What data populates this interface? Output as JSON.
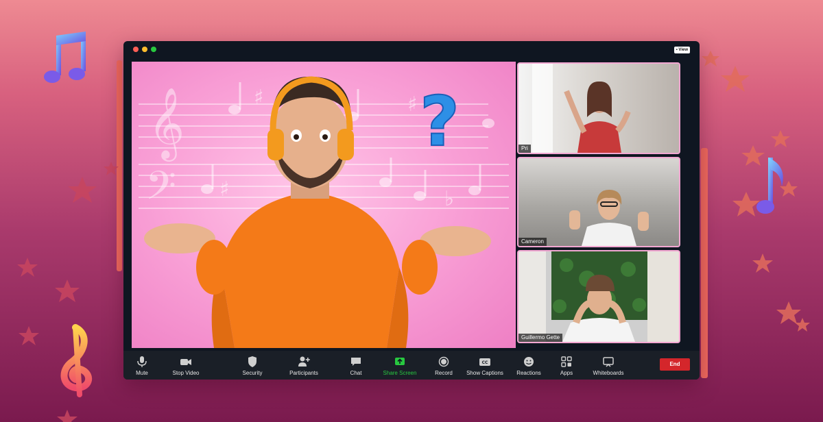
{
  "colors": {
    "accent": "#f06a5e",
    "end_button": "#d4262b",
    "share_green": "#28c840",
    "window_bg": "#0f1621",
    "toolbar_bg": "#1a1f27"
  },
  "window": {
    "view_label": "View"
  },
  "participants": [
    {
      "name": "Pri"
    },
    {
      "name": "Cameron"
    },
    {
      "name": "Guillermo Gette"
    }
  ],
  "toolbar": {
    "mute": "Mute",
    "stop_video": "Stop Video",
    "security": "Security",
    "participants": "Participants",
    "chat": "Chat",
    "share_screen": "Share Screen",
    "record": "Record",
    "show_captions": "Show Captions",
    "reactions": "Reactions",
    "apps": "Apps",
    "whiteboards": "Whiteboards",
    "end": "End",
    "cc_glyph": "CC"
  },
  "icons": [
    "microphone-icon",
    "video-camera-icon",
    "shield-icon",
    "add-participant-icon",
    "chat-bubble-icon",
    "share-arrow-icon",
    "record-icon",
    "captions-icon",
    "smiley-icon",
    "apps-icon",
    "whiteboard-icon",
    "music-note-icon",
    "treble-clef-icon",
    "star-icon"
  ]
}
